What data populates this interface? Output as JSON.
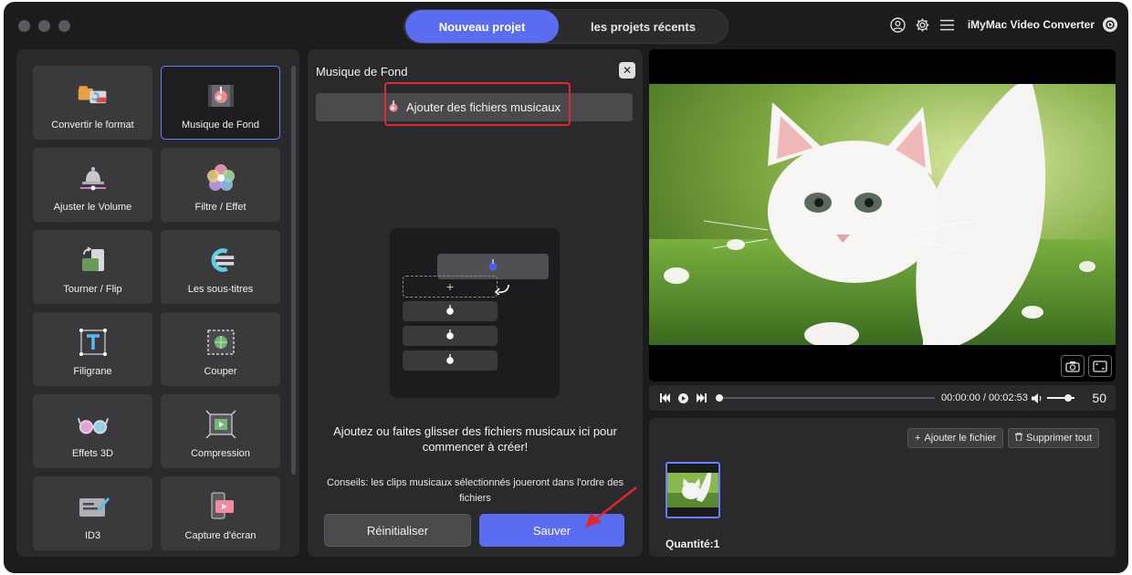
{
  "window": {
    "tabs": {
      "new_project": "Nouveau projet",
      "recent_projects": "les projets récents"
    },
    "brand": "iMyMac Video Converter"
  },
  "tools": [
    {
      "label": "Convertir le format",
      "icon": "convert-format-icon"
    },
    {
      "label": "Musique de Fond",
      "icon": "background-music-icon",
      "selected": true
    },
    {
      "label": "Ajuster le Volume",
      "icon": "volume-bell-icon"
    },
    {
      "label": "Filtre / Effet",
      "icon": "filter-effect-icon"
    },
    {
      "label": "Tourner / Flip",
      "icon": "rotate-flip-icon"
    },
    {
      "label": "Les sous-titres",
      "icon": "subtitles-icon"
    },
    {
      "label": "Filigrane",
      "icon": "watermark-icon"
    },
    {
      "label": "Couper",
      "icon": "crop-icon"
    },
    {
      "label": "Effets 3D",
      "icon": "3d-glasses-icon"
    },
    {
      "label": "Compression",
      "icon": "compression-icon"
    },
    {
      "label": "ID3",
      "icon": "id3-tag-icon"
    },
    {
      "label": "Capture d'écran",
      "icon": "screen-capture-icon"
    }
  ],
  "music_panel": {
    "title": "Musique de Fond",
    "add_button": "Ajouter des fichiers musicaux",
    "drop_text": "Ajoutez ou faites glisser des fichiers musicaux ici pour commencer à créer!",
    "tip": "Conseils: les clips musicaux sélectionnés joueront dans l'ordre des fichiers",
    "reset_button": "Réinitialiser",
    "save_button": "Sauver"
  },
  "player": {
    "time": "00:00:00 / 00:02:53",
    "volume": "50"
  },
  "file_list": {
    "add_file": "Ajouter le fichier",
    "delete_all": "Supprimer tout",
    "quantity": "Quantité:1"
  },
  "colors": {
    "accent": "#5a6cf0",
    "highlight": "#e3262a",
    "background": "#1c1c1e",
    "panel": "#2a2a2d"
  }
}
